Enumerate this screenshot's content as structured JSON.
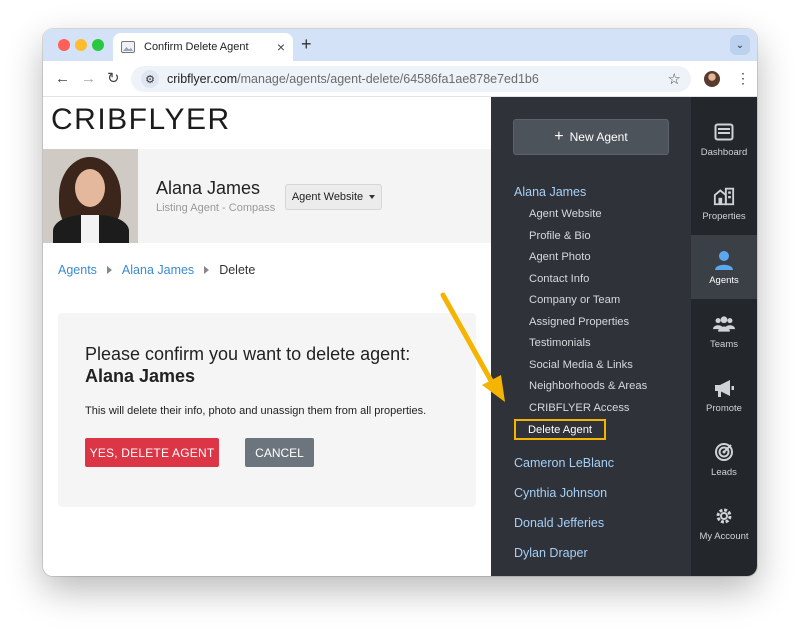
{
  "browser": {
    "tab_title": "Confirm Delete Agent",
    "tab_close": "×",
    "new_tab": "+",
    "tab_menu": "⌄",
    "url_host": "cribflyer.com",
    "url_path": "/manage/agents/agent-delete/64586fa1ae878e7ed1b6",
    "back": "←",
    "forward": "→",
    "reload": "↻",
    "star": "☆",
    "menu": "⋮"
  },
  "logo": "CRIBFLYER",
  "agent": {
    "name": "Alana James",
    "subtitle": "Listing Agent - Compass",
    "website_button": "Agent Website"
  },
  "breadcrumb": [
    "Agents",
    "Alana James",
    "Delete"
  ],
  "confirm": {
    "title": "Please confirm you want to delete agent:",
    "agent_name": "Alana James",
    "note": "This will delete their info, photo and unassign them from all properties.",
    "delete_button": "YES, DELETE AGENT",
    "cancel_button": "CANCEL"
  },
  "sidebar": {
    "new_agent": "New Agent",
    "current_agent": "Alana James",
    "sub_items": [
      "Agent Website",
      "Profile & Bio",
      "Agent Photo",
      "Contact Info",
      "Company or Team",
      "Assigned Properties",
      "Testimonials",
      "Social Media & Links",
      "Neighborhoods & Areas",
      "CRIBFLYER Access",
      "Delete Agent"
    ],
    "other_agents": [
      "Cameron LeBlanc",
      "Cynthia Johnson",
      "Donald Jefferies",
      "Dylan Draper"
    ]
  },
  "rail": [
    {
      "label": "Dashboard",
      "icon": "dashboard-icon"
    },
    {
      "label": "Properties",
      "icon": "properties-icon"
    },
    {
      "label": "Agents",
      "icon": "agent-icon",
      "active": true
    },
    {
      "label": "Teams",
      "icon": "teams-icon"
    },
    {
      "label": "Promote",
      "icon": "megaphone-icon"
    },
    {
      "label": "Leads",
      "icon": "target-icon"
    },
    {
      "label": "My Account",
      "icon": "gear-icon"
    }
  ],
  "colors": {
    "danger": "#dc3545",
    "secondary": "#6c757d",
    "link": "#3a8bd4",
    "sidebar_bg": "#2f3339",
    "highlight": "#f4b400"
  }
}
